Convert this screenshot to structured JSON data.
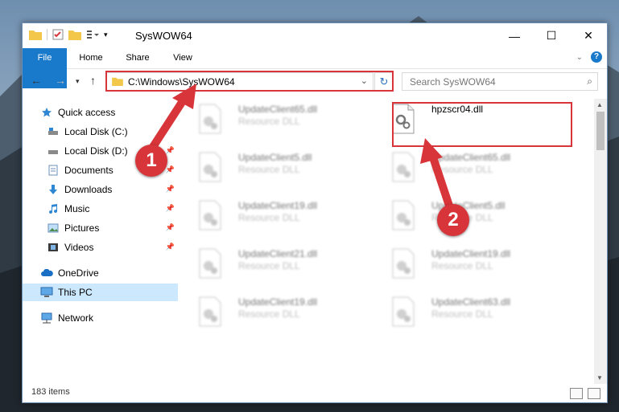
{
  "window": {
    "title": "SysWOW64"
  },
  "ribbon": {
    "tabs": [
      "File",
      "Home",
      "Share",
      "View"
    ]
  },
  "address": {
    "path": "C:\\Windows\\SysWOW64"
  },
  "search": {
    "placeholder": "Search SysWOW64"
  },
  "sidebar": {
    "items": [
      {
        "label": "Quick access"
      },
      {
        "label": "Local Disk (C:)"
      },
      {
        "label": "Local Disk (D:)"
      },
      {
        "label": "Documents"
      },
      {
        "label": "Downloads"
      },
      {
        "label": "Music"
      },
      {
        "label": "Pictures"
      },
      {
        "label": "Videos"
      },
      {
        "label": "OneDrive"
      },
      {
        "label": "This PC"
      },
      {
        "label": "Network"
      }
    ]
  },
  "files": [
    {
      "name": "UpdateClient65.dll",
      "desc": "Resource DLL"
    },
    {
      "name": "hpzscr04.dll",
      "desc": ""
    },
    {
      "name": "UpdateClient5.dll",
      "desc": "Resource DLL"
    },
    {
      "name": "UpdateClient65.dll",
      "desc": "Resource DLL"
    },
    {
      "name": "UpdateClient19.dll",
      "desc": "Resource DLL"
    },
    {
      "name": "UpdateClient5.dll",
      "desc": "Resource DLL"
    },
    {
      "name": "UpdateClient21.dll",
      "desc": "Resource DLL"
    },
    {
      "name": "UpdateClient19.dll",
      "desc": "Resource DLL"
    },
    {
      "name": "UpdateClient19.dll",
      "desc": "Resource DLL"
    },
    {
      "name": "UpdateClient63.dll",
      "desc": "Resource DLL"
    }
  ],
  "status": {
    "count": "183 items"
  },
  "markers": {
    "one": "1",
    "two": "2"
  },
  "colors": {
    "accent": "#1979ca",
    "highlight": "#d8353a",
    "selected": "#cce8ff"
  }
}
